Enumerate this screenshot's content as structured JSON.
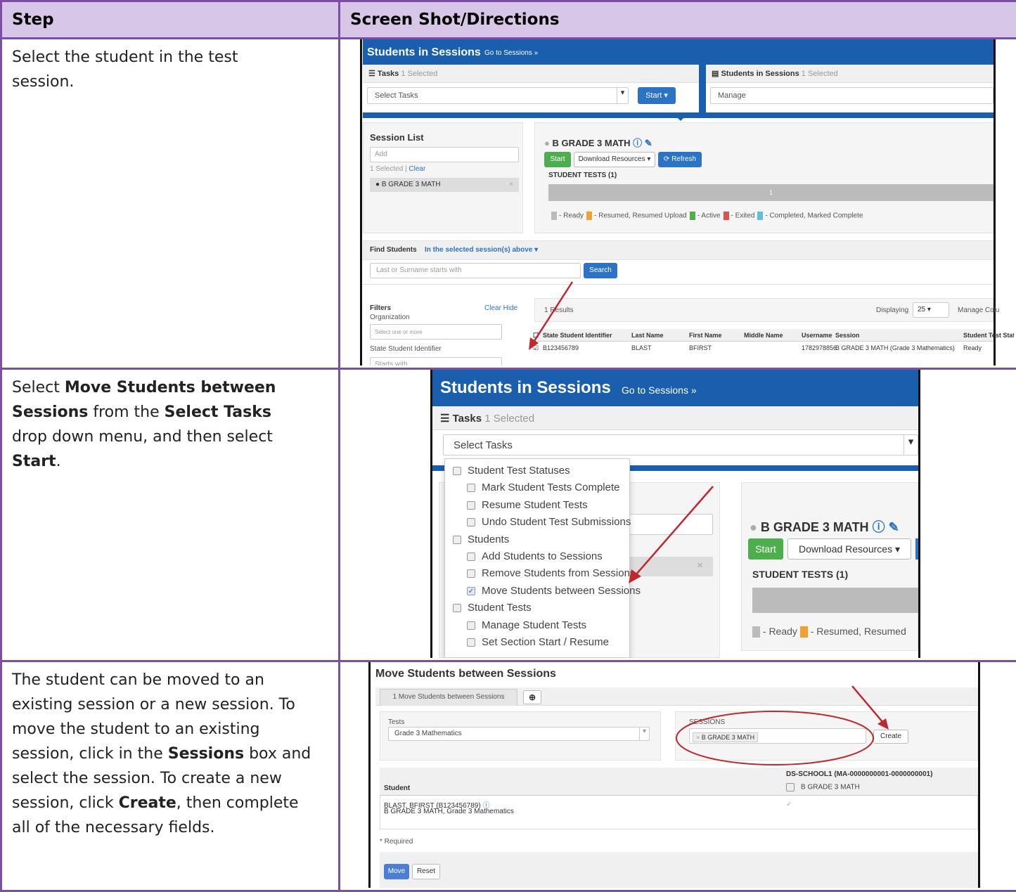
{
  "header": {
    "step": "Step",
    "directions": "Screen Shot/Directions"
  },
  "rows": [
    {
      "text": "Select the student in the test session."
    },
    {
      "text_parts": [
        "Select ",
        "Move Students between Sessions",
        " from the ",
        "Select Tasks",
        " drop down menu, and then select ",
        "Start",
        "."
      ]
    },
    {
      "text_parts": [
        "The student can be moved to an existing session or a new session. To move the student to an existing session, click in the ",
        "Sessions",
        " box and select the session. To create a new session, click ",
        "Create",
        ", then complete all of the necessary fields."
      ]
    }
  ],
  "shot1": {
    "title": "Students in Sessions",
    "goto": "Go to Sessions »",
    "tasks_label": "Tasks",
    "tasks_count": "1 Selected",
    "select_tasks": "Select Tasks",
    "start": "Start",
    "sis_label": "Students in Sessions",
    "sis_count": "1 Selected",
    "manage": "Manage",
    "session_list": "Session List",
    "add_placeholder": "Add",
    "selected_text": "1 Selected |",
    "clear": "Clear",
    "session_item": "B GRADE 3 MATH",
    "session_title": "B GRADE 3 MATH",
    "download": "Download Resources ▾",
    "refresh": "Refresh",
    "student_tests": "STUDENT TESTS (1)",
    "bar_count": "1",
    "legend": [
      {
        "color": "#bbbbbb",
        "label": "- Ready"
      },
      {
        "color": "#f0a030",
        "label": "- Resumed, Resumed Upload"
      },
      {
        "color": "#4cae4c",
        "label": "- Active"
      },
      {
        "color": "#d9534f",
        "label": "- Exited"
      },
      {
        "color": "#5bc0de",
        "label": "- Completed, Marked Complete"
      }
    ],
    "find_students": "Find Students",
    "in_selected": "In the selected session(s) above ▾",
    "search_placeholder": "Last or Surname starts with",
    "search": "Search",
    "filters": "Filters",
    "clear_hide": "Clear Hide",
    "organization": "Organization",
    "select_one": "Select one or more",
    "ssid_label": "State Student Identifier",
    "starts_with": "Starts with",
    "results": "1 Results",
    "displaying": "Displaying",
    "per_page": "25",
    "manage_columns": "Manage Colu",
    "columns": [
      "State Student Identifier",
      "Last Name",
      "First Name",
      "Middle Name",
      "Username",
      "Session",
      "Student Test Status"
    ],
    "row": [
      "B123456789",
      "BLAST",
      "BFIRST",
      "",
      "1782978856",
      "B GRADE 3 MATH (Grade 3 Mathematics)",
      "Ready"
    ]
  },
  "shot2": {
    "title": "Students in Sessions",
    "goto": "Go to Sessions »",
    "tasks_label": "Tasks",
    "tasks_count": "1 Selected",
    "select_tasks": "Select Tasks",
    "menu": [
      {
        "label": "Student Test Statuses",
        "indent": 0,
        "checked": false
      },
      {
        "label": "Mark Student Tests Complete",
        "indent": 1,
        "checked": false
      },
      {
        "label": "Resume Student Tests",
        "indent": 1,
        "checked": false
      },
      {
        "label": "Undo Student Test Submissions",
        "indent": 1,
        "checked": false
      },
      {
        "label": "Students",
        "indent": 0,
        "checked": false
      },
      {
        "label": "Add Students to Sessions",
        "indent": 1,
        "checked": false
      },
      {
        "label": "Remove Students from Sessions",
        "indent": 1,
        "checked": false
      },
      {
        "label": "Move Students between Sessions",
        "indent": 1,
        "checked": true
      },
      {
        "label": "Student Tests",
        "indent": 0,
        "checked": false
      },
      {
        "label": "Manage Student Tests",
        "indent": 1,
        "checked": false
      },
      {
        "label": "Set Section Start / Resume",
        "indent": 1,
        "checked": false
      }
    ],
    "session_title": "B GRADE 3 MATH",
    "start": "Start",
    "download": "Download Resources ▾",
    "student_tests": "STUDENT TESTS (1)",
    "legend_ready": "- Ready",
    "legend_resumed": "- Resumed, Resumed"
  },
  "shot3": {
    "title": "Move Students between Sessions",
    "tab": "1 Move Students between Sessions",
    "tests_label": "Tests",
    "tests_value": "Grade 3 Mathematics",
    "sessions_label": "SESSIONS",
    "session_tag": "B GRADE 3 MATH",
    "create": "Create",
    "org_header": "DS-SCHOOL1 (MA-0000000001-0000000001)",
    "student_header": "Student",
    "session_col": "B GRADE 3 MATH",
    "student_name": "BLAST, BFIRST (B123456789)",
    "student_sub": "B GRADE 3 MATH, Grade 3 Mathematics",
    "required": "* Required",
    "move": "Move",
    "reset": "Reset"
  }
}
